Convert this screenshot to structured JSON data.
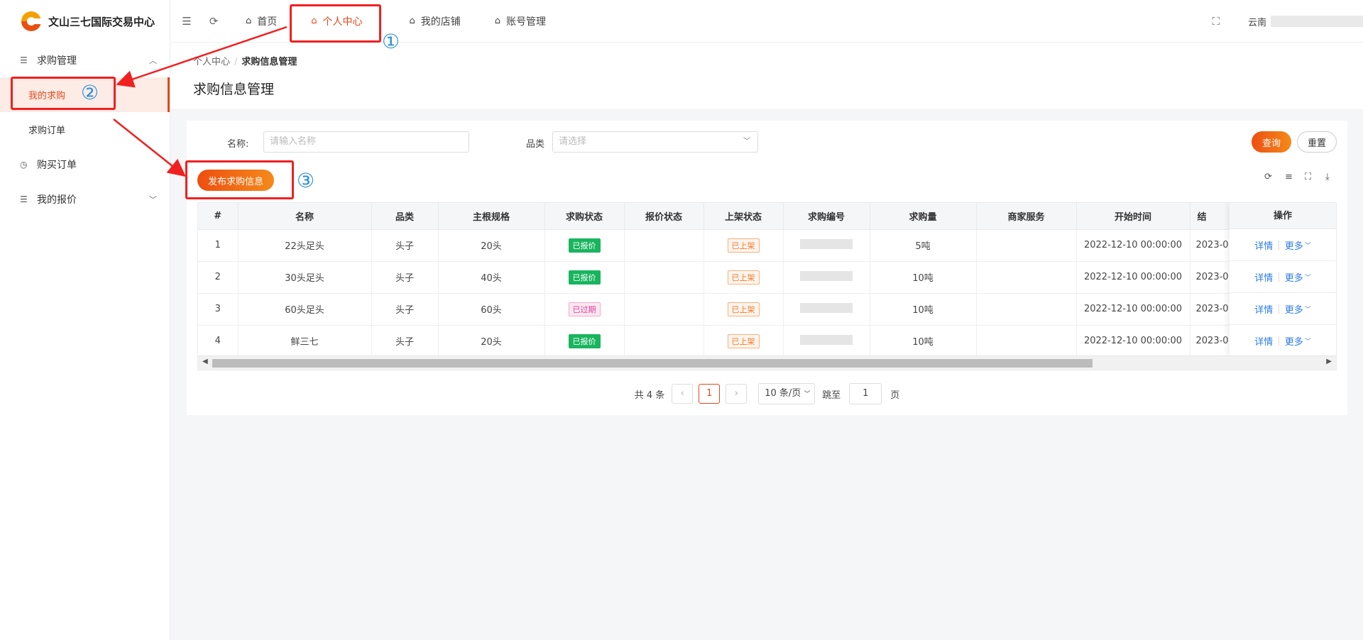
{
  "app": {
    "title": "文山三七国际交易中心"
  },
  "sidebar": {
    "groups": [
      {
        "label": "求购管理",
        "items": [
          {
            "label": "我的求购"
          },
          {
            "label": "求购订单"
          }
        ]
      },
      {
        "label": "购买订单"
      },
      {
        "label": "我的报价"
      }
    ]
  },
  "topbar": {
    "tabs": [
      {
        "label": "首页"
      },
      {
        "label": "个人中心"
      },
      {
        "label": "我的店铺"
      },
      {
        "label": "账号管理"
      }
    ],
    "user_prefix": "云南"
  },
  "breadcrumb": {
    "root": "个人中心",
    "current": "求购信息管理"
  },
  "page_title": "求购信息管理",
  "filters": {
    "name_label": "名称:",
    "name_placeholder": "请输入名称",
    "category_label": "品类",
    "category_placeholder": "请选择",
    "query_label": "查询",
    "reset_label": "重置"
  },
  "publish_label": "发布求购信息",
  "table": {
    "columns": [
      "#",
      "名称",
      "品类",
      "主根规格",
      "求购状态",
      "报价状态",
      "上架状态",
      "求购编号",
      "求购量",
      "商家服务",
      "开始时间",
      "结"
    ],
    "op_header": "操作",
    "rows": [
      {
        "idx": "1",
        "name": "22头足头",
        "category": "头子",
        "spec": "20头",
        "status": "已报价",
        "quote": "",
        "shelf": "已上架",
        "qty": "5吨",
        "service": "",
        "start": "2022-12-10 00:00:00",
        "end": "2023-0"
      },
      {
        "idx": "2",
        "name": "30头足头",
        "category": "头子",
        "spec": "40头",
        "status": "已报价",
        "quote": "",
        "shelf": "已上架",
        "qty": "10吨",
        "service": "",
        "start": "2022-12-10 00:00:00",
        "end": "2023-0"
      },
      {
        "idx": "3",
        "name": "60头足头",
        "category": "头子",
        "spec": "60头",
        "status": "已过期",
        "quote": "",
        "shelf": "已上架",
        "qty": "10吨",
        "service": "",
        "start": "2022-12-10 00:00:00",
        "end": "2023-0"
      },
      {
        "idx": "4",
        "name": "鲜三七",
        "category": "头子",
        "spec": "20头",
        "status": "已报价",
        "quote": "",
        "shelf": "已上架",
        "qty": "10吨",
        "service": "",
        "start": "2022-12-10 00:00:00",
        "end": "2023-0"
      }
    ],
    "op_detail": "详情",
    "op_more": "更多"
  },
  "pagination": {
    "total": "共 4 条",
    "current": "1",
    "page_size": "10 条/页",
    "jump_label": "跳至",
    "jump_value": "1",
    "page_suffix": "页"
  },
  "annotations": {
    "n1": "①",
    "n2": "②",
    "n3": "③"
  },
  "colors": {
    "accent": "#e5481a",
    "annotation_red": "#f02020",
    "annotation_blue": "#2b8fe0",
    "tag_green": "#19b55e",
    "link": "#2c7be5"
  }
}
